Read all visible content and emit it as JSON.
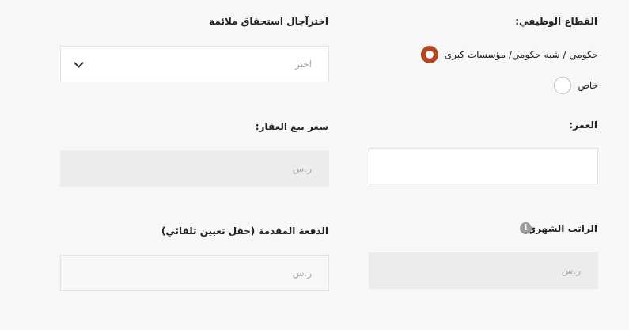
{
  "employment_sector": {
    "label": "القطاع الوظيفي:",
    "options": [
      {
        "label": "حكومي / شبه حكومي/ مؤسسات كبرى",
        "selected": true
      },
      {
        "label": "خاص",
        "selected": false
      }
    ]
  },
  "deferral_period": {
    "label": "اخترآجال استحقاق ملائمة",
    "placeholder": "اختر"
  },
  "age": {
    "label": "العمر:",
    "value": ""
  },
  "property_price": {
    "label": "سعر بيع العقار:",
    "placeholder": "ر.س"
  },
  "monthly_salary": {
    "label": "الراتب الشهري",
    "placeholder": "ر.س",
    "info_icon": "info-icon"
  },
  "down_payment": {
    "label": "الدفعة المقدمة (حقل تعيين تلقائي)",
    "placeholder": "ر.س"
  },
  "colors": {
    "accent": "#b0471f",
    "background": "#f7f7f7",
    "disabled_field": "#ececec"
  }
}
